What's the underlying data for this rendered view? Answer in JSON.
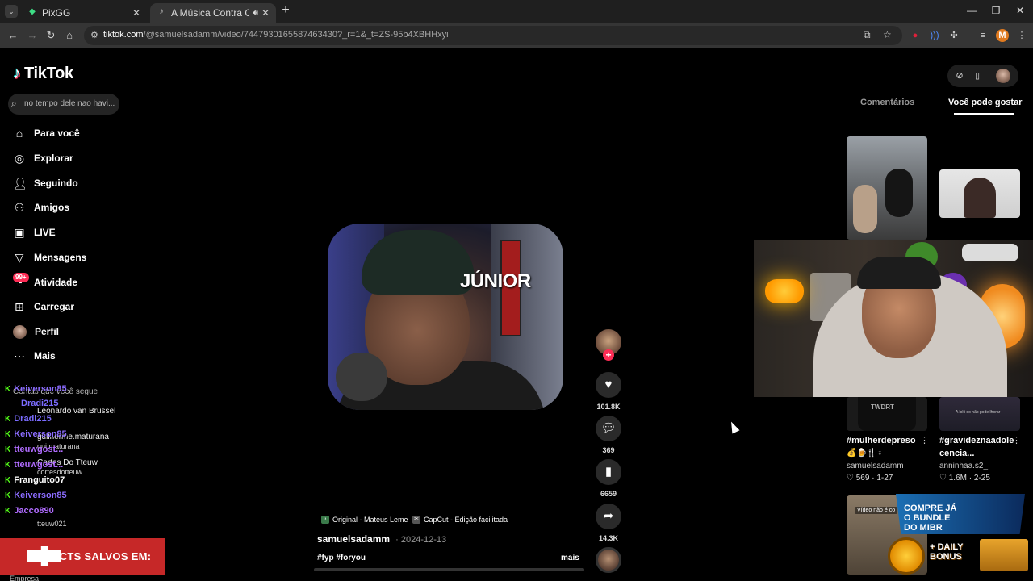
{
  "browser": {
    "tabs": [
      {
        "title": "PixGG",
        "icon": "pixgg-icon",
        "active": false
      },
      {
        "title": "A Música Contra Colonial d",
        "icon": "tiktok-icon",
        "active": true,
        "audio": true
      }
    ],
    "url_host": "tiktok.com",
    "url_path": "/@samuelsadamm/video/7447930165587463430?_r=1&_t=ZS-95b4XBHHxyi",
    "profile_initial": "M"
  },
  "tiktok": {
    "logo": "TikTok",
    "search_value": "no tempo dele nao havi...",
    "nav": [
      {
        "label": "Para você",
        "icon": "home-icon"
      },
      {
        "label": "Explorar",
        "icon": "compass-icon"
      },
      {
        "label": "Seguindo",
        "icon": "user-follow-icon"
      },
      {
        "label": "Amigos",
        "icon": "friends-icon"
      },
      {
        "label": "LIVE",
        "icon": "live-icon"
      },
      {
        "label": "Mensagens",
        "icon": "messages-icon"
      },
      {
        "label": "Atividade",
        "icon": "activity-icon"
      },
      {
        "label": "Carregar",
        "icon": "upload-icon"
      },
      {
        "label": "Perfil",
        "icon": "profile-avatar"
      },
      {
        "label": "Mais",
        "icon": "more-icon"
      }
    ],
    "activity_badge": "99+",
    "following_header": "Contas que você segue",
    "following": [
      {
        "name": "Leonardo van Brussel"
      },
      {
        "name": "guilherme.maturana",
        "handle": "gui.maturana"
      },
      {
        "name": "Cortes Do Tteuw",
        "handle": "cortesdotteuw"
      },
      {
        "name": "tteuw021",
        "handle": "tteuw021"
      }
    ],
    "video": {
      "overlay_text": "JÚNIOR",
      "author": "samuelsadamm",
      "date": "2024-12-13",
      "hashtags": "#fyp #foryou",
      "more": "mais",
      "sound": "Original - Mateus Leme",
      "effect": "CapCut - Edição facilitada",
      "progress": 0.0
    },
    "actions": {
      "likes": "101.8K",
      "comments": "369",
      "saves": "6659",
      "shares": "14.3K"
    },
    "right_tabs": {
      "comments": "Comentários",
      "suggested": "Você pode gostar"
    },
    "suggested": [
      {
        "title": "#mulherdepreso",
        "sub": "💰🍺🍴♁",
        "author": "samuelsadamm",
        "likes": "569",
        "date": "1-27"
      },
      {
        "title": "#gravideznaadole",
        "title2": "cencia...",
        "author": "anninhaa.s2_",
        "likes": "1.6M",
        "date": "2-25"
      }
    ],
    "thumb_tags": {
      "th5": "Vídeo não é co",
      "th4": "A loki do não pode lhorar",
      "th3": "TWDRT"
    }
  },
  "stream": {
    "chat": [
      {
        "user": "Keiverson85",
        "color": "#8b6cff"
      },
      {
        "user": "Dradi215",
        "color": "#7b6cff"
      },
      {
        "user": "Dradi215",
        "color": "#7b6cff"
      },
      {
        "user": "Keiverson85",
        "color": "#8b6cff"
      },
      {
        "user": "tteuwgost...",
        "color": "#b06cff"
      },
      {
        "user": "tteuwgost...",
        "color": "#b06cff"
      },
      {
        "user": "Franguito07",
        "color": "#ffffff"
      },
      {
        "user": "Keiverson85",
        "color": "#8b6cff"
      },
      {
        "user": "Jacco890",
        "color": "#b06cff"
      }
    ],
    "banner": "ACTS SALVOS EM:",
    "empresa": "Empresa",
    "promo_top": "COMPRE JÁ\nO BUNDLE\nDO MIBR",
    "promo_bottom": "+ DAILY\nBONUS"
  },
  "colors": {
    "accent": "#fe2c55",
    "kick_green": "#53fc18",
    "banner_red": "#c62828"
  }
}
